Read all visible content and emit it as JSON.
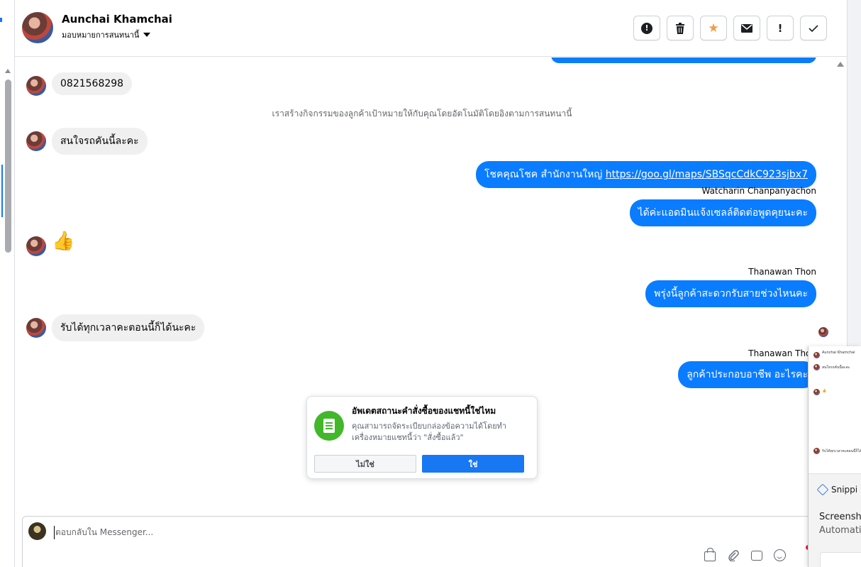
{
  "header": {
    "contact_name": "Aunchai Khamchai",
    "assign_label": "มอบหมายการสนทนานี้",
    "actions": [
      {
        "name": "spam-alert",
        "icon": "alert-circle-icon"
      },
      {
        "name": "delete",
        "icon": "trash-icon"
      },
      {
        "name": "star",
        "icon": "star-icon"
      },
      {
        "name": "mark-unread",
        "icon": "envelope-icon"
      },
      {
        "name": "follow-up",
        "icon": "exclamation-icon"
      },
      {
        "name": "mark-done",
        "icon": "checkmark-icon"
      }
    ]
  },
  "chat": {
    "messages": [
      {
        "direction": "in",
        "text": "0821568298"
      },
      {
        "direction": "system",
        "text": "เราสร้างกิจกรรมของลูกค้าเป้าหมายให้กับคุณโดยอัตโนมัติโดยอิงตามการสนทนานี้"
      },
      {
        "direction": "in",
        "text": "สนใจรถคันนี้ละคะ"
      },
      {
        "direction": "out",
        "text": "โชคคุณโชค สำนักงานใหญ่ ",
        "link": "https://goo.gl/maps/SBSqcCdkC923sjbx7"
      },
      {
        "direction": "out",
        "sender": "Watcharin Chanpanyachon",
        "text": "ได้ค่ะแอดมินแจ้งเซลล์ติดต่อพูดคุยนะคะ"
      },
      {
        "direction": "in",
        "text": "👍"
      },
      {
        "direction": "out",
        "sender": "Thanawan Thon",
        "text": "พรุ่งนี้ลูกค้าสะดวกรับสายช่วงไหนคะ"
      },
      {
        "direction": "in",
        "text": "รับได้ทุกเวลาคะตอนนี้ก็ได้นะคะ"
      },
      {
        "direction": "out",
        "sender": "Thanawan Thon",
        "text": "ลูกค้าประกอบอาชีพ อะไรคะ"
      }
    ]
  },
  "popup": {
    "title": "อัพเดตสถานะคำสั่งซื้อของแชทนี้ใช่ไหม",
    "body": "คุณสามารถจัดระเบียบกล่องข้อความได้โดยทำเครื่องหมายแชทนี้ว่า \"สั่งซื้อแล้ว\"",
    "no_label": "ไม่ใช่",
    "yes_label": "ใช่"
  },
  "composer": {
    "placeholder": "ตอบกลับใน Messenger...",
    "tools": [
      "shopping-bag-icon",
      "paperclip-icon",
      "quick-reply-icon",
      "emoji-icon"
    ]
  },
  "snip_overlay": {
    "mini_labels": [
      "Aunchai Khamchai",
      "สนใจรถคันนี้ละคะ",
      "👍",
      "รับได้ทุกเวลาคะตอนนี้ก็ได้นะคะ"
    ],
    "app_name": "Snippi",
    "title": "Screensho",
    "subtitle": "Automatic"
  },
  "colors": {
    "outgoing_bubble": "#0a7cff",
    "incoming_bubble": "#f0f0f0",
    "primary_button": "#1877f2",
    "popup_icon": "#42b72a",
    "star": "#f39c3d"
  }
}
